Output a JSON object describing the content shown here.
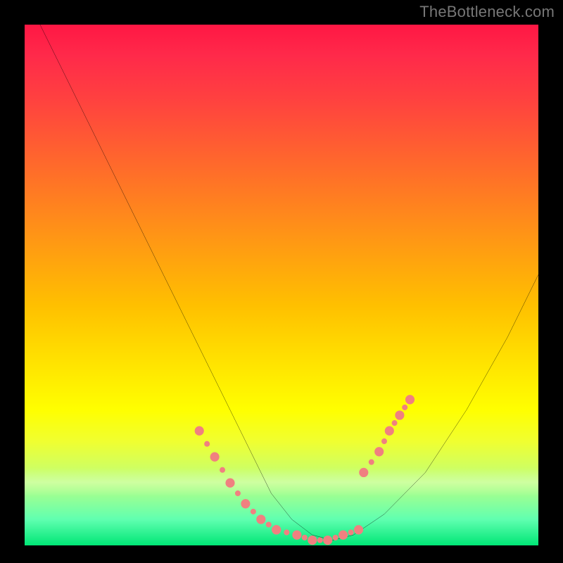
{
  "watermark": "TheBottleneck.com",
  "chart_data": {
    "type": "line",
    "title": "",
    "xlabel": "",
    "ylabel": "",
    "xlim": [
      0,
      100
    ],
    "ylim": [
      0,
      100
    ],
    "grid": false,
    "legend": false,
    "series": [
      {
        "name": "curve",
        "color": "#000000",
        "x": [
          3,
          7,
          12,
          18,
          24,
          30,
          36,
          41,
          45,
          48,
          52,
          56,
          60,
          64,
          70,
          78,
          86,
          94,
          100
        ],
        "y": [
          100,
          92,
          82,
          70,
          58,
          46,
          34,
          24,
          16,
          10,
          5,
          2,
          1,
          2,
          6,
          14,
          26,
          40,
          52
        ]
      }
    ],
    "annotations": {
      "dotted_segments": {
        "color": "#f08080",
        "style": "dotted",
        "segments": [
          {
            "name": "left-arm",
            "x": [
              34,
              37,
              40,
              43,
              46,
              49
            ],
            "y": [
              22,
              17,
              12,
              8,
              5,
              3
            ]
          },
          {
            "name": "bottom",
            "x": [
              49,
              53,
              56,
              59,
              62,
              65
            ],
            "y": [
              3,
              2,
              1,
              1,
              2,
              3
            ]
          },
          {
            "name": "right-arm",
            "x": [
              66,
              69,
              71,
              73,
              75
            ],
            "y": [
              14,
              18,
              22,
              25,
              28
            ]
          }
        ]
      }
    },
    "background": {
      "type": "vertical-gradient",
      "stops": [
        {
          "pos": 0,
          "color": "#ff1744"
        },
        {
          "pos": 50,
          "color": "#ffc000"
        },
        {
          "pos": 75,
          "color": "#ffff00"
        },
        {
          "pos": 100,
          "color": "#00e676"
        }
      ]
    }
  }
}
